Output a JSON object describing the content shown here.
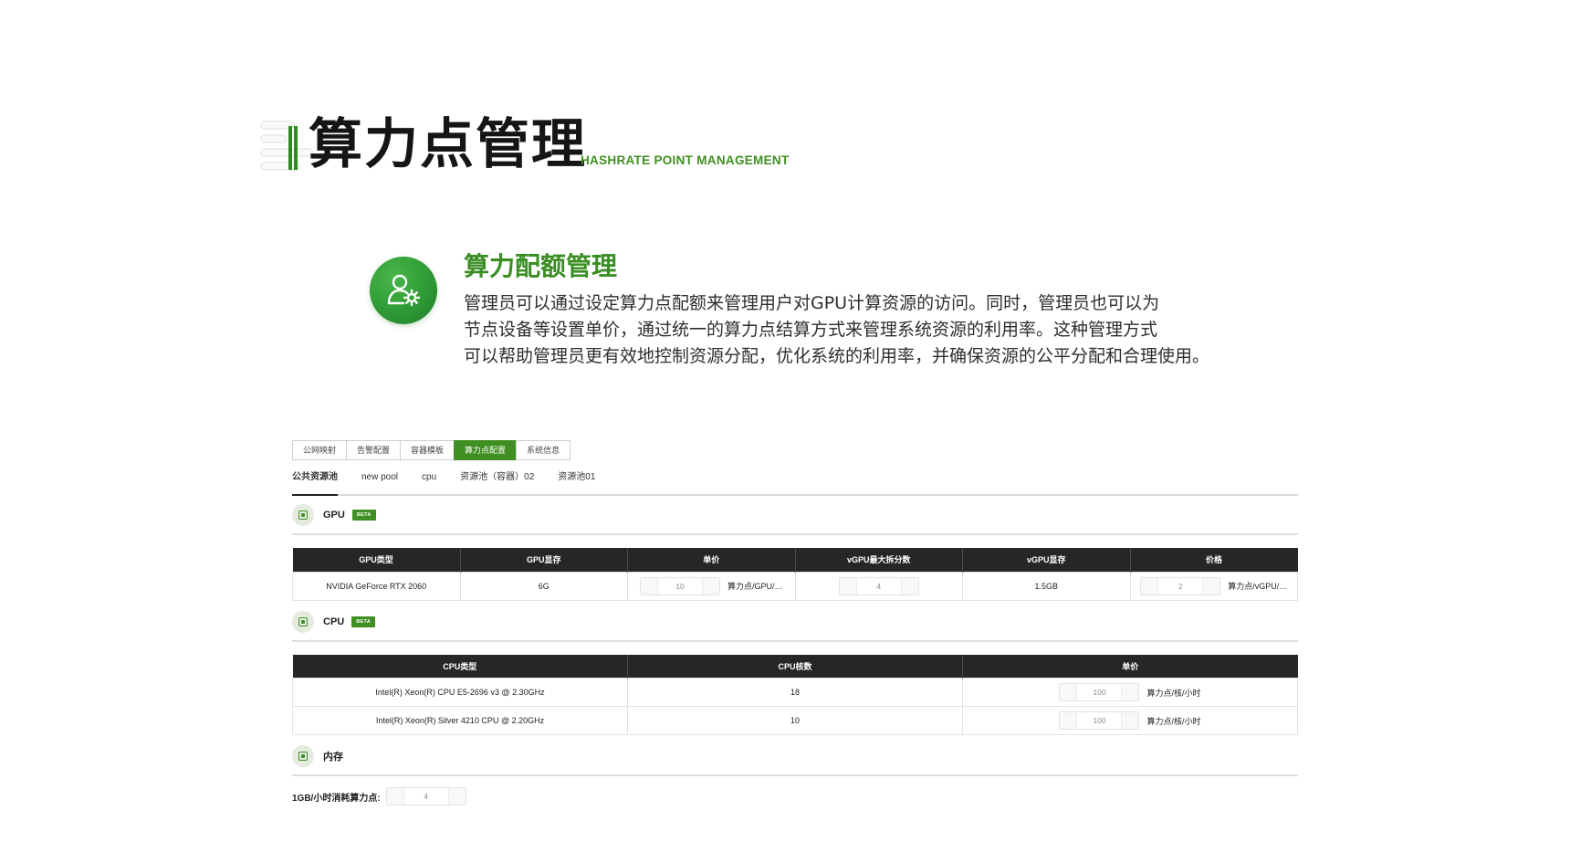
{
  "header": {
    "title": "算力点管理",
    "subtitle": "HASHRATE POINT MANAGEMENT"
  },
  "feature": {
    "icon": "user-gear-icon",
    "title": "算力配额管理",
    "description_lines": [
      "管理员可以通过设定算力点配额来管理用户对GPU计算资源的访问。同时，管理员也可以为",
      "节点设备等设置单价，通过统一的算力点结算方式来管理系统资源的利用率。这种管理方式",
      "可以帮助管理员更有效地控制资源分配，优化系统的利用率，并确保资源的公平分配和合理使用。"
    ]
  },
  "colors": {
    "accent": "#3f8f22",
    "table_header": "#262626"
  },
  "panel": {
    "tabs": [
      {
        "label": "公网映射",
        "active": false
      },
      {
        "label": "告警配置",
        "active": false
      },
      {
        "label": "容器模板",
        "active": false
      },
      {
        "label": "算力点配置",
        "active": true
      },
      {
        "label": "系统信息",
        "active": false
      }
    ],
    "pools": [
      {
        "label": "公共资源池",
        "active": true
      },
      {
        "label": "new pool",
        "active": false
      },
      {
        "label": "cpu",
        "active": false
      },
      {
        "label": "资源池（容器）02",
        "active": false
      },
      {
        "label": "资源池01",
        "active": false
      }
    ],
    "gpu": {
      "title": "GPU",
      "badge": "BETA",
      "columns": [
        "GPU类型",
        "GPU显存",
        "单价",
        "vGPU最大拆分数",
        "vGPU显存",
        "价格"
      ],
      "rows": [
        {
          "type": "NVIDIA GeForce RTX 2060",
          "memory": "6G",
          "price": "10",
          "price_unit": "算力点/GPU/…",
          "max_split": "4",
          "vgpu_memory": "1.5GB",
          "vgpu_price": "2",
          "vgpu_price_unit": "算力点/vGPU/…"
        }
      ]
    },
    "cpu": {
      "title": "CPU",
      "badge": "BETA",
      "columns": [
        "CPU类型",
        "CPU核数",
        "单价"
      ],
      "rows": [
        {
          "type": "Intel(R) Xeon(R) CPU E5-2696 v3 @ 2.30GHz",
          "cores": "18",
          "price": "100",
          "price_unit": "算力点/核/小时"
        },
        {
          "type": "Intel(R) Xeon(R) Silver 4210 CPU @ 2.20GHz",
          "cores": "10",
          "price": "100",
          "price_unit": "算力点/核/小时"
        }
      ]
    },
    "memory": {
      "title": "内存",
      "label": "1GB/小时消耗算力点:",
      "value": "4"
    }
  }
}
